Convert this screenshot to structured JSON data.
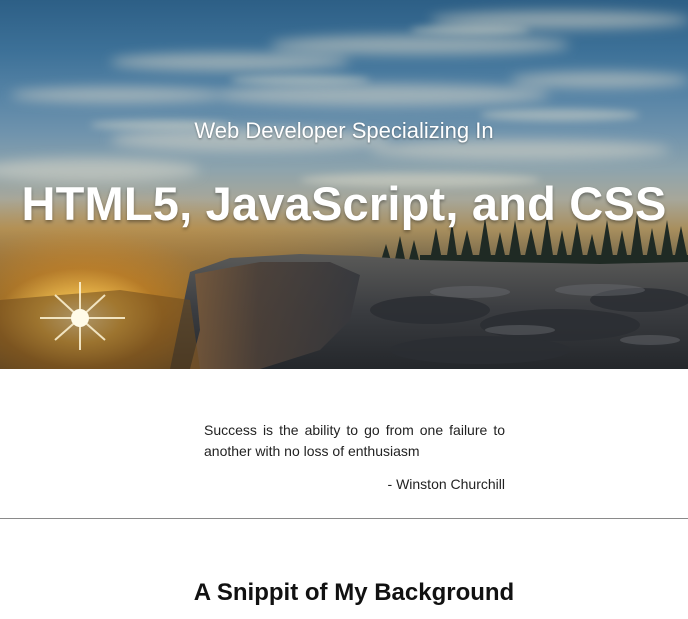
{
  "hero": {
    "subtitle": "Web Developer Specializing In",
    "title": "HTML5, JavaScript, and CSS"
  },
  "quote": {
    "text": "Success is the ability to go from one failure to another with no loss of enthusiasm",
    "author": "- Winston Churchill"
  },
  "background": {
    "heading": "A Snippit of My Background"
  }
}
